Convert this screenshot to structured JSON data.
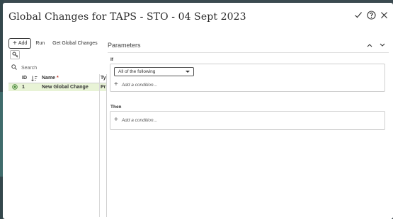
{
  "dialog": {
    "title": "Global Changes for TAPS - STO - 04 Sept 2023"
  },
  "header_icons": [
    "check-icon",
    "help-icon",
    "close-icon"
  ],
  "toolbar": {
    "add_label": "Add",
    "run_label": "Run",
    "get_label": "Get Global Changes"
  },
  "search": {
    "placeholder": "Search"
  },
  "grid": {
    "columns": {
      "id": "ID",
      "name": "Name",
      "name_required": "*",
      "type": "Ty"
    },
    "rows": [
      {
        "id": "1",
        "name": "New Global Change",
        "type": "Pr"
      }
    ]
  },
  "parameters": {
    "title": "Parameters",
    "if_label": "If",
    "if_select": "All of the following",
    "if_add_condition": "Add a condition...",
    "then_label": "Then",
    "then_add_condition": "Add a condition..."
  },
  "colors": {
    "row_selected": "#e8f3d6",
    "status_green": "#4a8a3a",
    "required_red": "#c0392b"
  }
}
